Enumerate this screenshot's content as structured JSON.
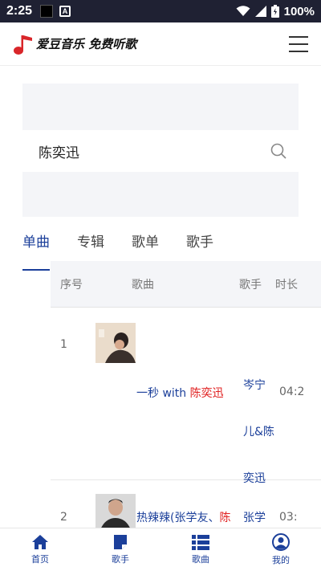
{
  "status_bar": {
    "time": "2:25",
    "battery": "100%"
  },
  "header": {
    "logo_text": "爱豆音乐 免费听歌"
  },
  "search": {
    "value": "陈奕迅"
  },
  "tabs": [
    {
      "label": "单曲",
      "active": true
    },
    {
      "label": "专辑",
      "active": false
    },
    {
      "label": "歌单",
      "active": false
    },
    {
      "label": "歌手",
      "active": false
    }
  ],
  "table": {
    "headers": {
      "index": "序号",
      "song": "歌曲",
      "singer": "歌手",
      "duration": "时长"
    },
    "rows": [
      {
        "index": "1",
        "song_prefix": "一秒 with ",
        "song_highlight": "陈奕迅",
        "song_suffix": "",
        "singer_lines": [
          "岑宁",
          "儿&陈",
          "奕迅"
        ],
        "duration": "04:2"
      },
      {
        "index": "2",
        "song_prefix": "热辣辣(张学友、",
        "song_highlight": "陈",
        "song_suffix": "",
        "singer_lines": [
          "张学"
        ],
        "duration": "03:"
      }
    ]
  },
  "bottom_nav": [
    {
      "label": "首页",
      "icon": "home-icon"
    },
    {
      "label": "歌手",
      "icon": "singer-note-icon"
    },
    {
      "label": "歌曲",
      "icon": "song-list-icon"
    },
    {
      "label": "我的",
      "icon": "user-icon"
    }
  ],
  "colors": {
    "accent": "#1b3f9a",
    "highlight": "#e02020",
    "status_bar": "#1f2133",
    "logo_red": "#d9262a"
  }
}
